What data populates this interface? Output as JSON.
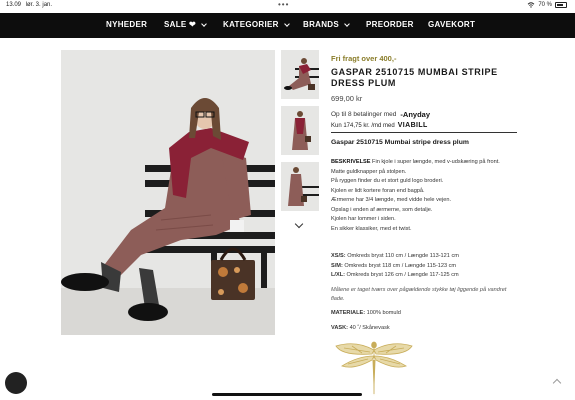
{
  "status_bar": {
    "time": "13.09",
    "date": "lør. 3. jan.",
    "battery": "70 %",
    "battery_level": 0.7
  },
  "nav": {
    "items": [
      {
        "label": "NYHEDER",
        "has_dropdown": false
      },
      {
        "label": "SALE ❤",
        "has_dropdown": true
      },
      {
        "label": "KATEGORIER",
        "has_dropdown": true
      },
      {
        "label": "BRANDS",
        "has_dropdown": true
      },
      {
        "label": "PREORDER",
        "has_dropdown": false
      },
      {
        "label": "GAVEKORT",
        "has_dropdown": false
      }
    ]
  },
  "product": {
    "free_shipping": "Fri fragt over 400,-",
    "title": "GASPAR 2510715 MUMBAI STRIPE DRESS PLUM",
    "price": "699,00 kr",
    "installments_text": "Op til 8 betalinger med",
    "installments_provider": "Anyday",
    "monthly_amount": "Kun 174,75 kr. /md med",
    "monthly_provider": "VIABILL",
    "subtitle": "Gaspar 2510715 Mumbai stripe dress plum",
    "description_label": "BESKRIVELSE",
    "description_lines": [
      "Fin kjole i super længde, med v-udskæring på front.",
      "Matte guldknapper på stolpen.",
      "På ryggen finder du et stort guld logo broderi.",
      "Kjolen er lidt kortere foran end bagpå.",
      "Ærmerne har 3/4 længde, med vidde hele vejen.",
      "Opslag i enden af ærmerne, som detalje.",
      "Kjolen har lommer i siden.",
      "En sikker klassiker, med et twist."
    ],
    "sizes": [
      {
        "size": "XS/S:",
        "text": "Omkreds bryst 110 cm / Længde 113-121 cm"
      },
      {
        "size": "S/M:",
        "text": "Omkreds bryst 118 cm / Længde 115-123 cm"
      },
      {
        "size": "L/XL:",
        "text": "Omkreds bryst 126 cm / Længde 117-125 cm"
      }
    ],
    "measure_note": "Målene er taget tværs over pågældende stykke tøj liggende på vandret flade.",
    "material_label": "MATERIALE:",
    "material_value": "100% bomuld",
    "wash_label": "VASK:",
    "wash_value": "40 ˚/ Skånevask"
  },
  "icons": {
    "nav_dropdown": "chevron-down-icon",
    "thumbs_next": "chevron-down-icon",
    "logo_mark": "dragonfly-icon",
    "scroll_top": "chevron-up-icon"
  },
  "colors": {
    "nav_bg": "#0d0d0d",
    "free_shipping": "#8a7d2a",
    "dress": "#8d5d58",
    "scarf": "#8a2136",
    "dragonfly": "#c8ad5a"
  }
}
